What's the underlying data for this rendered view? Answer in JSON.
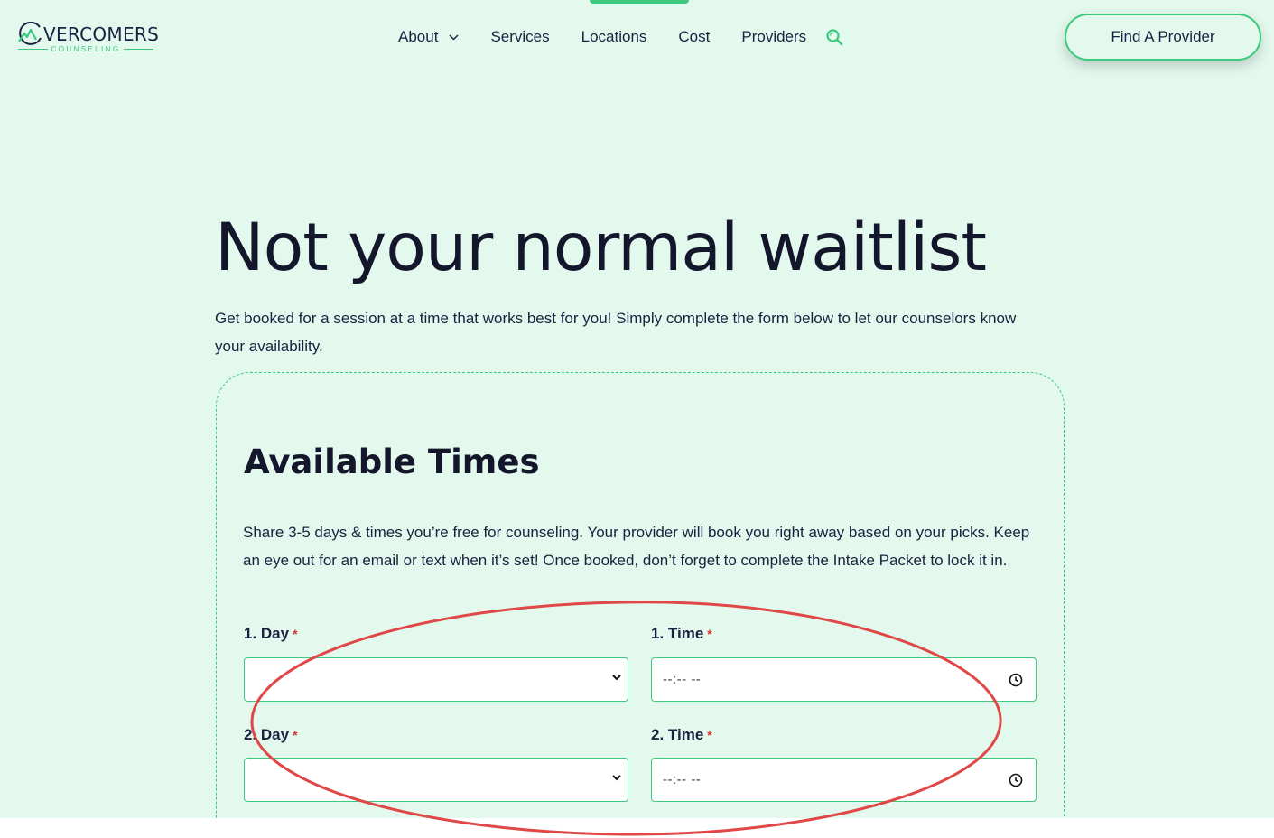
{
  "header": {
    "logo": {
      "word": "VERCOMERS",
      "sub": "COUNSELING"
    },
    "nav": [
      {
        "label": "About",
        "has_dropdown": true
      },
      {
        "label": "Services"
      },
      {
        "label": "Locations"
      },
      {
        "label": "Cost"
      },
      {
        "label": "Providers"
      }
    ],
    "search_icon": "search-icon",
    "cta_label": "Find A Provider"
  },
  "hero": {
    "title": "Not your normal waitlist",
    "subtitle": "Get booked for a session at a time that works best for you! Simply complete the form below to let our counselors know your availability."
  },
  "form": {
    "title": "Available Times",
    "description": "Share 3-5 days & times you’re free for counseling. Your provider will book you right away based on your picks.  Keep an eye out for an email or text when it’s set! Once booked, don’t forget to complete the Intake Packet to lock it in.",
    "required_mark": "*",
    "rows": [
      {
        "day_label": "1. Day",
        "time_label": "1. Time",
        "day_value": "",
        "time_placeholder": "--:-- --"
      },
      {
        "day_label": "2. Day",
        "time_label": "2.  Time",
        "day_value": "",
        "time_placeholder": "--:-- --"
      }
    ]
  },
  "colors": {
    "background": "#e3f9ee",
    "accent": "#3cc97d",
    "text": "#14162b",
    "required": "#dd3333",
    "annotation": "#e04848"
  }
}
